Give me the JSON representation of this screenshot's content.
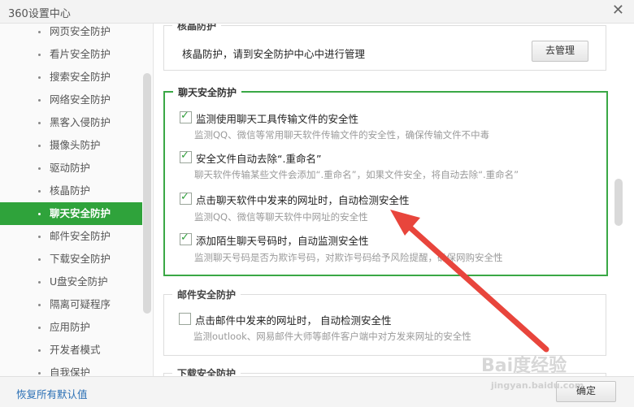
{
  "window": {
    "title": "360设置中心",
    "close_glyph": "✕"
  },
  "sidebar": {
    "items": [
      {
        "label": "网页安全防护",
        "active": false
      },
      {
        "label": "看片安全防护",
        "active": false
      },
      {
        "label": "搜索安全防护",
        "active": false
      },
      {
        "label": "网络安全防护",
        "active": false
      },
      {
        "label": "黑客入侵防护",
        "active": false
      },
      {
        "label": "摄像头防护",
        "active": false
      },
      {
        "label": "驱动防护",
        "active": false
      },
      {
        "label": "核晶防护",
        "active": false
      },
      {
        "label": "聊天安全防护",
        "active": true
      },
      {
        "label": "邮件安全防护",
        "active": false
      },
      {
        "label": "下载安全防护",
        "active": false
      },
      {
        "label": "U盘安全防护",
        "active": false
      },
      {
        "label": "隔离可疑程序",
        "active": false
      },
      {
        "label": "应用防护",
        "active": false
      },
      {
        "label": "开发者模式",
        "active": false
      },
      {
        "label": "自我保护",
        "active": false
      }
    ]
  },
  "kernel_section": {
    "title": "核晶防护",
    "text": "核晶防护，请到安全防护中心中进行管理",
    "manage_button": "去管理"
  },
  "chat_section": {
    "title": "聊天安全防护",
    "options": [
      {
        "label": "监测使用聊天工具传输文件的安全性",
        "desc": "监测QQ、微信等常用聊天软件传输文件的安全性，确保传输文件不中毒",
        "checked": true
      },
      {
        "label": "安全文件自动去除“.重命名”",
        "desc": "聊天软件传输某些文件会添加“.重命名”，如果文件安全，将自动去除“.重命名”",
        "checked": true
      },
      {
        "label": "点击聊天软件中发来的网址时，自动检测安全性",
        "desc": "监测QQ、微信等聊天软件中网址的安全性",
        "checked": true
      },
      {
        "label": "添加陌生聊天号码时，自动监测安全性",
        "desc": "监测聊天号码是否为欺诈号码，对欺诈号码给予风险提醒，确保网购安全性",
        "checked": true
      }
    ]
  },
  "mail_section": {
    "title": "邮件安全防护",
    "options": [
      {
        "label": "点击邮件中发来的网址时， 自动检测安全性",
        "desc": "监测outlook、网易邮件大师等邮件客户端中对方发来网址的安全性",
        "checked": false
      }
    ]
  },
  "download_section": {
    "title": "下载安全防护"
  },
  "footer": {
    "restore_link": "恢复所有默认值",
    "confirm_button": "确定"
  },
  "watermark": {
    "top": "Bai度经验",
    "bottom": "jingyan.baidu.com"
  },
  "colors": {
    "accent": "#2fa33b",
    "arrow": "#e8453c",
    "link": "#2a6fb5"
  }
}
